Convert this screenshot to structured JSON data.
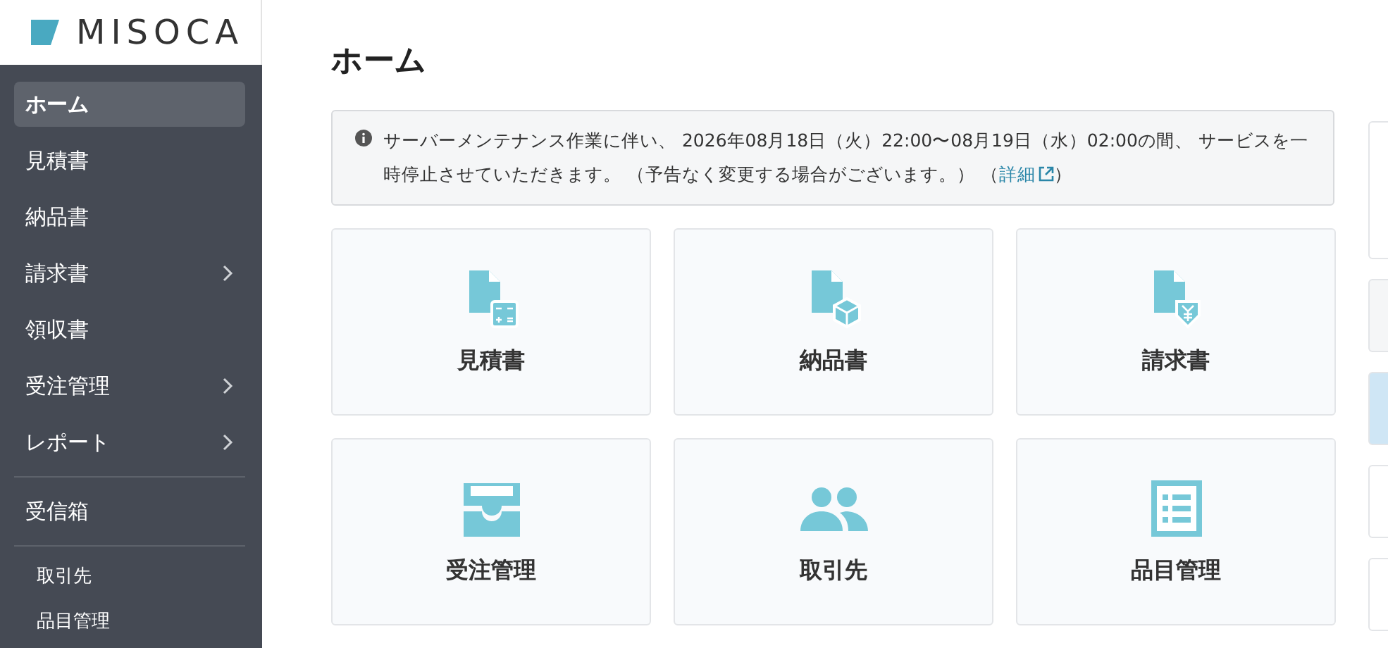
{
  "logo": {
    "text": "MISOCA"
  },
  "sidebar": {
    "items": [
      {
        "label": "ホーム",
        "kind": "main",
        "selected": true,
        "has_submenu": false
      },
      {
        "label": "見積書",
        "kind": "main",
        "selected": false,
        "has_submenu": false
      },
      {
        "label": "納品書",
        "kind": "main",
        "selected": false,
        "has_submenu": false
      },
      {
        "label": "請求書",
        "kind": "main",
        "selected": false,
        "has_submenu": true
      },
      {
        "label": "領収書",
        "kind": "main",
        "selected": false,
        "has_submenu": false
      },
      {
        "label": "受注管理",
        "kind": "main",
        "selected": false,
        "has_submenu": true
      },
      {
        "label": "レポート",
        "kind": "main",
        "selected": false,
        "has_submenu": true
      },
      {
        "kind": "divider"
      },
      {
        "label": "受信箱",
        "kind": "main",
        "selected": false,
        "has_submenu": false
      },
      {
        "kind": "divider"
      },
      {
        "label": "取引先",
        "kind": "sub",
        "selected": false
      },
      {
        "label": "品目管理",
        "kind": "sub",
        "selected": false
      }
    ]
  },
  "page": {
    "title": "ホーム"
  },
  "notice": {
    "text": "サーバーメンテナンス作業に伴い、 2026年08月18日（火）22:00〜08月19日（水）02:00の間、 サービスを一時停止させていただきます。 （予告なく変更する場合がございます。） （",
    "link": "詳細",
    "after": "）"
  },
  "tiles": [
    {
      "label": "見積書",
      "kind": "estimate"
    },
    {
      "label": "納品書",
      "kind": "delivery"
    },
    {
      "label": "請求書",
      "kind": "invoice"
    },
    {
      "label": "受注管理",
      "kind": "orders"
    },
    {
      "label": "取引先",
      "kind": "clients"
    },
    {
      "label": "品目管理",
      "kind": "items"
    }
  ]
}
